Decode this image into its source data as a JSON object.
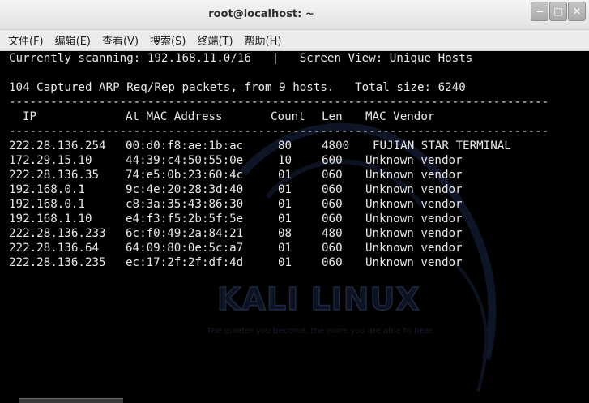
{
  "window": {
    "title": "root@localhost: ~",
    "buttons": {
      "minimize": "−",
      "maximize": "□",
      "close": "✕"
    }
  },
  "menu": [
    {
      "label": "文件(F)"
    },
    {
      "label": "编辑(E)"
    },
    {
      "label": "查看(V)"
    },
    {
      "label": "搜索(S)"
    },
    {
      "label": "终端(T)"
    },
    {
      "label": "帮助(H)"
    }
  ],
  "terminal": {
    "status_line": "Currently scanning: 192.168.11.0/16   |   Screen View: Unique Hosts",
    "summary_line": "104 Captured ARP Req/Rep packets, from 9 hosts.   Total size: 6240",
    "rule": "------------------------------------------------------------------------------",
    "headers": {
      "ip": "IP",
      "mac": "At MAC Address",
      "count": "Count",
      "len": "Len",
      "vendor": "MAC Vendor"
    },
    "rows": [
      {
        "ip": "222.28.136.254",
        "mac": "00:d0:f8:ae:1b:ac",
        "count": "80",
        "len": "4800",
        "vendor": "FUJIAN STAR TERMINAL"
      },
      {
        "ip": "172.29.15.10",
        "mac": "44:39:c4:50:55:0e",
        "count": "10",
        "len": "600",
        "vendor": "Unknown vendor"
      },
      {
        "ip": "222.28.136.35",
        "mac": "74:e5:0b:23:60:4c",
        "count": "01",
        "len": "060",
        "vendor": "Unknown vendor"
      },
      {
        "ip": "192.168.0.1",
        "mac": "9c:4e:20:28:3d:40",
        "count": "01",
        "len": "060",
        "vendor": "Unknown vendor"
      },
      {
        "ip": "192.168.0.1",
        "mac": "c8:3a:35:43:86:30",
        "count": "01",
        "len": "060",
        "vendor": "Unknown vendor"
      },
      {
        "ip": "192.168.1.10",
        "mac": "e4:f3:f5:2b:5f:5e",
        "count": "01",
        "len": "060",
        "vendor": "Unknown vendor"
      },
      {
        "ip": "222.28.136.233",
        "mac": "6c:f0:49:2a:84:21",
        "count": "08",
        "len": "480",
        "vendor": "Unknown vendor"
      },
      {
        "ip": "222.28.136.64",
        "mac": "64:09:80:0e:5c:a7",
        "count": "01",
        "len": "060",
        "vendor": "Unknown vendor"
      },
      {
        "ip": "222.28.136.235",
        "mac": "ec:17:2f:2f:df:4d",
        "count": "01",
        "len": "060",
        "vendor": "Unknown vendor"
      }
    ]
  },
  "wallpaper": {
    "logo_text": "KALI LINUX",
    "tagline": "The quieter you become, the more you are able to hear."
  },
  "colors": {
    "terminal_bg": "#000000",
    "terminal_fg": "#e8e8e8",
    "titlebar": "#e8e8e8"
  }
}
